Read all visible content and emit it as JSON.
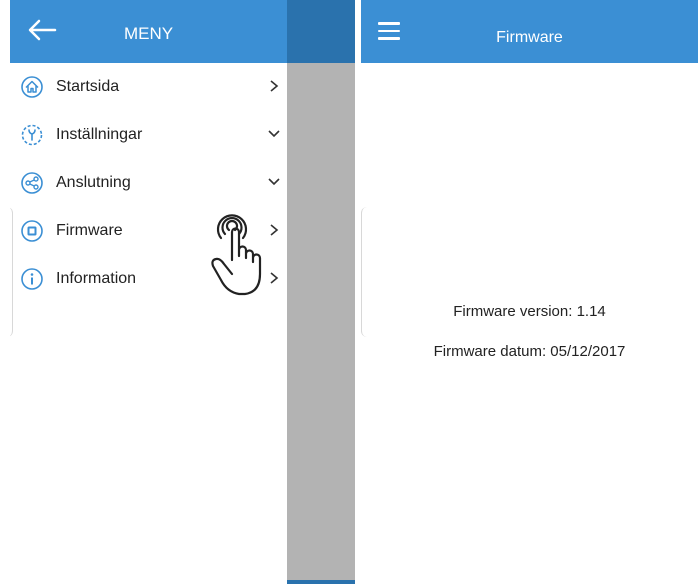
{
  "drawer_screen": {
    "title": "MENY",
    "items": [
      {
        "label": "Startsida",
        "icon": "home-icon",
        "arrow": "chevron-right-icon"
      },
      {
        "label": "Inställningar",
        "icon": "settings-wrench-icon",
        "arrow": "chevron-down-icon"
      },
      {
        "label": "Anslutning",
        "icon": "share-icon",
        "arrow": "chevron-down-icon"
      },
      {
        "label": "Firmware",
        "icon": "chip-icon",
        "arrow": "chevron-right-icon"
      },
      {
        "label": "Information",
        "icon": "info-icon",
        "arrow": "chevron-right-icon"
      }
    ]
  },
  "firmware_screen": {
    "title": "Firmware",
    "version_text": "Firmware version: 1.14",
    "date_text": "Firmware datum: 05/12/2017"
  },
  "colors": {
    "appbar": "#3b8fd4",
    "appbar_dim": "#2a72ad",
    "scrim": "#b3b3b3",
    "icon": "#3b8fd4"
  }
}
